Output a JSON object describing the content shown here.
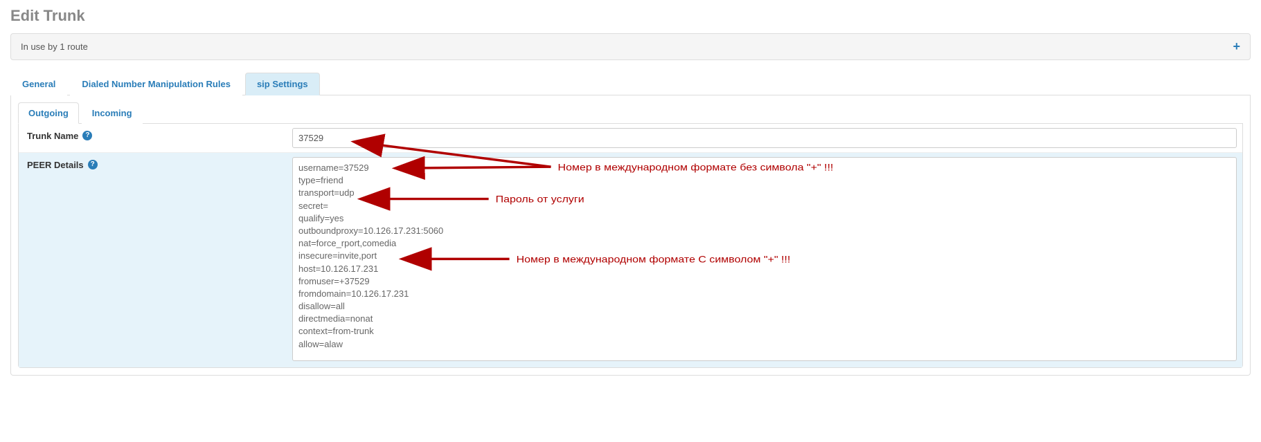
{
  "page_title": "Edit Trunk",
  "bar_text": "In use by 1 route",
  "tabs": {
    "general": "General",
    "dnmr": "Dialed Number Manipulation Rules",
    "sip": "sip Settings"
  },
  "subtabs": {
    "outgoing": "Outgoing",
    "incoming": "Incoming"
  },
  "fields": {
    "trunk_name_label": "Trunk Name",
    "trunk_name_value": "37529",
    "peer_details_label": "PEER Details",
    "peer_details_value": "username=37529\ntype=friend\ntransport=udp\nsecret=\nqualify=yes\noutboundproxy=10.126.17.231:5060\nnat=force_rport,comedia\ninsecure=invite,port\nhost=10.126.17.231\nfromuser=+37529\nfromdomain=10.126.17.231\ndisallow=all\ndirectmedia=nonat\ncontext=from-trunk\nallow=alaw"
  },
  "annotations": {
    "top": "Номер в международном формате без символа \"+\"  !!!",
    "middle": "Пароль от услуги",
    "bottom": "Номер в международном формате С символом \"+\" !!!"
  },
  "colors": {
    "annotation": "#b00000",
    "link": "#2a7db8",
    "highlight_row": "#e6f3fa"
  }
}
